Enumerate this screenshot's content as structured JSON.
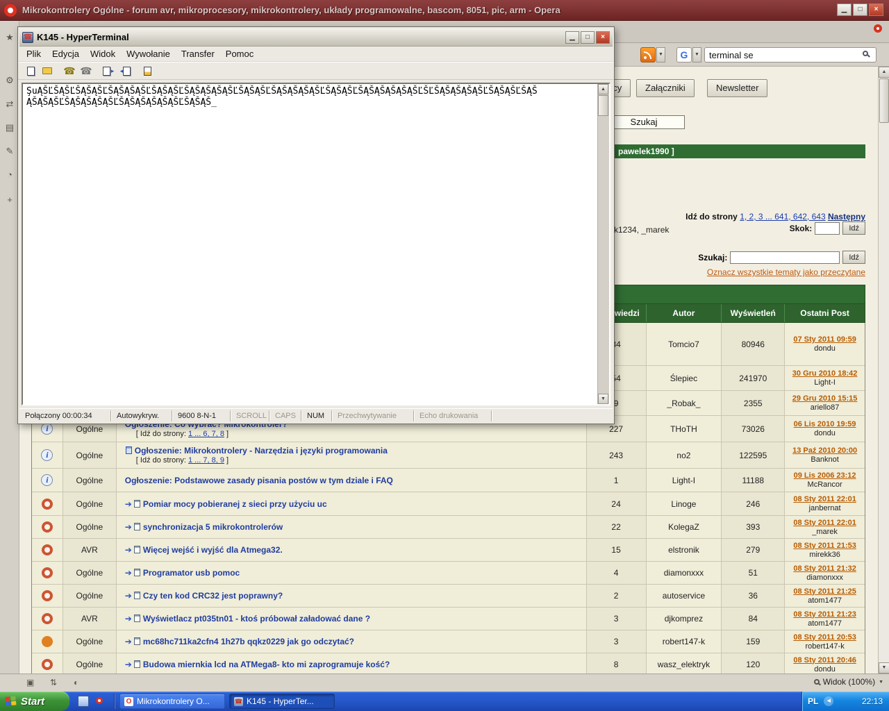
{
  "colors": {
    "opera_titlebar": "#7e3030",
    "taskbar_blue": "#2456c8",
    "start_green": "#3d9438",
    "forum_green": "#2f6d33",
    "page_beige": "#f2efe2",
    "topic_link_blue": "#1f3d9e",
    "date_link_orange": "#b85c00"
  },
  "glyphs": {
    "opera_logo": "O",
    "minimize": "▁",
    "maximize": "□",
    "close": "×",
    "dropdown": "▼",
    "scroll_up": "▲",
    "scroll_down": "▼",
    "tray_chevron": "◀",
    "topic_arrow": "➔",
    "info": "i",
    "phone": "☎",
    "send_arrow": "▸",
    "receive_arrow": "◂",
    "google": "G",
    "sidebar": [
      "★",
      "⚙",
      "⇄",
      "▤",
      "✎",
      "◔",
      "+"
    ],
    "status_icons": [
      "▣",
      "⇅",
      "◐"
    ]
  },
  "opera": {
    "window_title": "Mikrokontrolery Ogólne - forum avr, mikroprocesory, mikrokontrolery, układy programowalne, bascom, 8051, pic, arm - Opera",
    "search_value": "terminal se",
    "zoom_label": "Widok (100%)"
  },
  "forum": {
    "nav_tabs": [
      "Użytkownicy",
      "Załączniki",
      "Newsletter"
    ],
    "search_button": "Szukaj",
    "moderators_bar": "pawelek1990 ]",
    "moderators_fragment": "k1234, _marek",
    "pagination": {
      "label": "Idź do strony",
      "pages": "1, 2, 3 ... 641, 642, 643",
      "next": "Następny"
    },
    "jump": {
      "label": "Skok:",
      "go": "Idź"
    },
    "search_row": {
      "label": "Szukaj:",
      "go": "Idź"
    },
    "mark_read": "Oznacz wszystkie tematy jako przeczytane",
    "table": {
      "headers": [
        "",
        "",
        "",
        "Odpowiedzi",
        "Autor",
        "Wyświetleń",
        "Ostatni Post"
      ],
      "rows": [
        {
          "icon": null,
          "forum": "",
          "title": "",
          "replies": "34",
          "author": "Tomcio7",
          "views": "80946",
          "last_date": "07 Sty 2011 09:59",
          "last_user": "dondu"
        },
        {
          "icon": null,
          "forum": "",
          "title": "",
          "replies": "54",
          "author": "Ślepiec",
          "views": "241970",
          "last_date": "30 Gru 2010 18:42",
          "last_user": "Light-I"
        },
        {
          "icon": null,
          "forum": "",
          "title": "",
          "replies": "9",
          "author": "_Robak_",
          "views": "2355",
          "last_date": "29 Gru 2010 15:15",
          "last_user": "ariello87"
        },
        {
          "icon": "info",
          "forum": "Ogólne",
          "prefix": "Ogłoszenie:",
          "title": "Co wybrać? Mikrokontroler?",
          "pages_label": "[ Idź do strony:",
          "pages_links": "1 ... 6, 7, 8",
          "pages_suffix": "]",
          "replies": "227",
          "author": "THoTH",
          "views": "73026",
          "last_date": "06 Lis 2010 19:59",
          "last_user": "dondu"
        },
        {
          "icon": "info",
          "forum": "Ogólne",
          "prefix": "Ogłoszenie:",
          "title": "Mikrokontrolery - Narzędzia i języki programowania",
          "pages_label": "[ Idź do strony:",
          "pages_links": "1 ... 7, 8, 9",
          "pages_suffix": "]",
          "replies": "243",
          "author": "no2",
          "views": "122595",
          "last_date": "13 Paź 2010 20:00",
          "last_user": "Banknot"
        },
        {
          "icon": "info",
          "forum": "Ogólne",
          "prefix": "Ogłoszenie:",
          "title": "Podstawowe zasady pisania postów w tym dziale i FAQ",
          "replies": "1",
          "author": "Light-I",
          "views": "11188",
          "last_date": "09 Lis 2006 23:12",
          "last_user": "McRancor"
        },
        {
          "icon": "topic",
          "forum": "Ogólne",
          "title": "Pomiar mocy pobieranej z sieci przy użyciu uc",
          "replies": "24",
          "author": "Linoge",
          "views": "246",
          "last_date": "08 Sty 2011 22:01",
          "last_user": "janbernat"
        },
        {
          "icon": "topic",
          "forum": "Ogólne",
          "title": "synchronizacja 5 mikrokontrolerów",
          "replies": "22",
          "author": "KolegaZ",
          "views": "393",
          "last_date": "08 Sty 2011 22:01",
          "last_user": "_marek"
        },
        {
          "icon": "topic",
          "forum": "AVR",
          "title": "Więcej wejść i wyjść dla Atmega32.",
          "replies": "15",
          "author": "elstronik",
          "views": "279",
          "last_date": "08 Sty 2011 21:53",
          "last_user": "mirekk36"
        },
        {
          "icon": "topic",
          "forum": "Ogólne",
          "title": "Programator usb pomoc",
          "replies": "4",
          "author": "diamonxxx",
          "views": "51",
          "last_date": "08 Sty 2011 21:32",
          "last_user": "diamonxxx"
        },
        {
          "icon": "topic",
          "forum": "Ogólne",
          "title": "Czy ten kod CRC32 jest poprawny?",
          "replies": "2",
          "author": "autoservice",
          "views": "36",
          "last_date": "08 Sty 2011 21:25",
          "last_user": "atom1477"
        },
        {
          "icon": "topic",
          "forum": "AVR",
          "title": "Wyświetlacz pt035tn01 - ktoś próbował załadować dane ?",
          "replies": "3",
          "author": "djkomprez",
          "views": "84",
          "last_date": "08 Sty 2011 21:23",
          "last_user": "atom1477"
        },
        {
          "icon": "hot",
          "forum": "Ogólne",
          "title": "mc68hc711ka2cfn4 1h27b qqkz0229 jak go odczytać?",
          "replies": "3",
          "author": "robert147-k",
          "views": "159",
          "last_date": "08 Sty 2011 20:53",
          "last_user": "robert147-k"
        },
        {
          "icon": "topic",
          "forum": "Ogólne",
          "title": "Budowa miernkia lcd na ATMega8- kto mi zaprogramuje kość?",
          "replies": "8",
          "author": "wasz_elektryk",
          "views": "120",
          "last_date": "08 Sty 2011 20:46",
          "last_user": "dondu"
        }
      ]
    }
  },
  "hyperterminal": {
    "title": "K145 - HyperTerminal",
    "menu": [
      "Plik",
      "Edycja",
      "Widok",
      "Wywołanie",
      "Transfer",
      "Pomoc"
    ],
    "terminal_line1": "ŞuĄŠĽŠĄŠĽŠĄŠĄŠĽŠĄŠĄŠĄŠĽŠĄŠĄŠĽŠĄŠĄŠĄŠĄŠĽŠĄŠĄŠĽŠĄŠĄŠĄŠĄŠĽŠĄŠĄŠĽŠĄŠĄŠĄŠĄŠĄŠĽŠĽŠĄŠĄŠĄŠĄŠĽŠĄŠĄŠĽŠĄŠ",
    "terminal_line2": "ĄŠĄŠĄŠĽŠĄŠĄŠĄŠĄŠĽŠĄŠĄŠĄŠĄŠĄŠĽŠĄŠĄŠ_",
    "status_items": [
      {
        "label": "Połączony 00:00:34",
        "active": true
      },
      {
        "label": "Autowykryw.",
        "active": true
      },
      {
        "label": "9600 8-N-1",
        "active": true
      },
      {
        "label": "SCROLL",
        "active": false
      },
      {
        "label": "CAPS",
        "active": false
      },
      {
        "label": "NUM",
        "active": true
      },
      {
        "label": "Przechwytywanie",
        "active": false
      },
      {
        "label": "Echo drukowania",
        "active": false
      }
    ]
  },
  "taskbar": {
    "start_label": "Start",
    "window_buttons": [
      {
        "label": "Mikrokontrolery O...",
        "active": false
      },
      {
        "label": "K145 - HyperTer...",
        "active": true
      }
    ],
    "tray_lang": "PL",
    "tray_time": "22:13"
  }
}
